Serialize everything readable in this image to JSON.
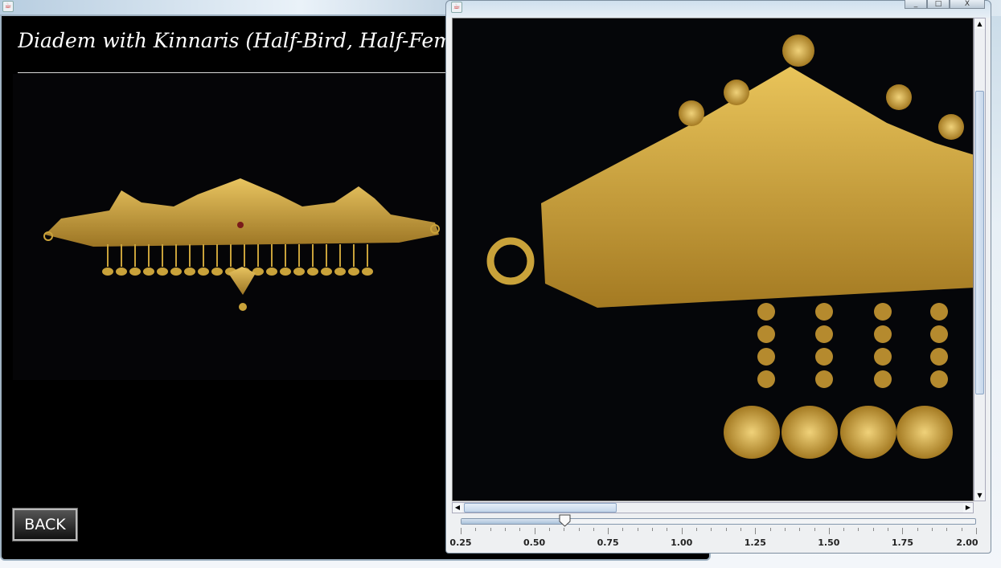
{
  "left_window": {
    "title": "Diadem with Kinnaris (Half-Bird, Half-Female Creatures)",
    "back_label": "BACK"
  },
  "right_window": {
    "window_buttons": {
      "minimize": "_",
      "maximize": "□",
      "close": "X"
    },
    "zoom_slider": {
      "min": 0.25,
      "max": 2.0,
      "value": 0.6,
      "labels": [
        "0.25",
        "0.50",
        "0.75",
        "1.00",
        "1.25",
        "1.50",
        "1.75",
        "2.00"
      ]
    },
    "vertical_scroll_fraction": 0.15,
    "horizontal_scroll_fraction": 0.0
  },
  "colors": {
    "gold": "#c9a23a",
    "background": "#000000",
    "slider_fill": "#a9c1da"
  }
}
